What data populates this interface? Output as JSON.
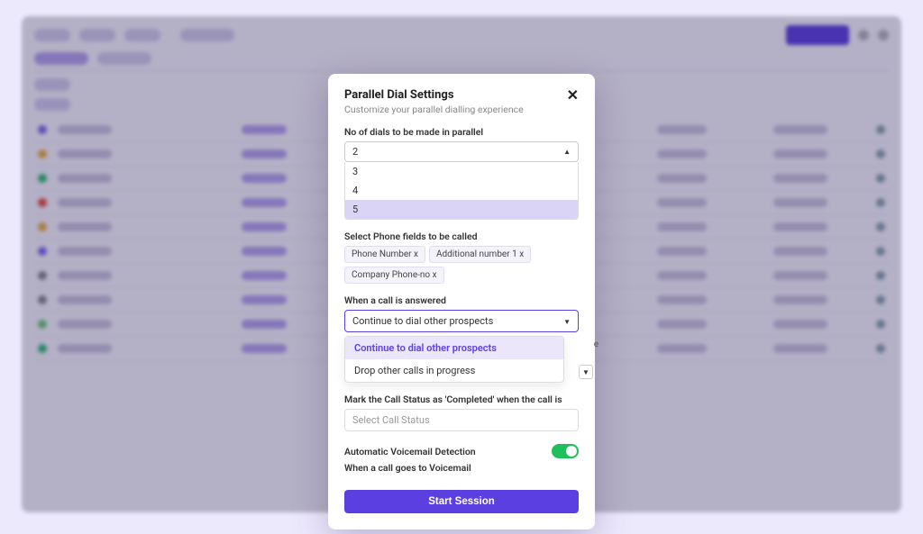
{
  "modal": {
    "title": "Parallel Dial Settings",
    "subtitle": "Customize your parallel dialling experience",
    "close": "✕",
    "labels": {
      "parallel": "No of dials to be made in parallel",
      "phone_fields": "Select Phone fields to be called",
      "answered": "When a call is answered",
      "mark_completed": "Mark the Call Status as 'Completed' when the call is",
      "voicemail_detect": "Automatic Voicemail Detection",
      "voicemail_goes": "When a call goes to Voicemail"
    },
    "parallel": {
      "selected": "2",
      "options": [
        "3",
        "4",
        "5"
      ],
      "highlight_index": 2
    },
    "phone_chips": [
      "Phone Number x",
      "Additional number 1 x",
      "Company Phone-no x"
    ],
    "answered": {
      "selected": "Continue to dial other prospects",
      "options": [
        "Continue to dial other prospects",
        "Drop other calls in progress"
      ],
      "side_char": "e"
    },
    "call_status_placeholder": "Select Call Status",
    "voicemail_toggle_on": true,
    "start_button": "Start Session"
  },
  "background": {
    "primary_button": "",
    "tabs": [
      "",
      ""
    ],
    "row_dot_colors": [
      "#7c6df0",
      "#f0b23c",
      "#2fc06a",
      "#f04b3c",
      "#f0b23c",
      "#7c6df0",
      "#888",
      "#888",
      "#6bcf6b",
      "#2fc06a"
    ]
  },
  "colors": {
    "accent": "#5b3fe0",
    "toggle_on": "#1fbf5b"
  }
}
